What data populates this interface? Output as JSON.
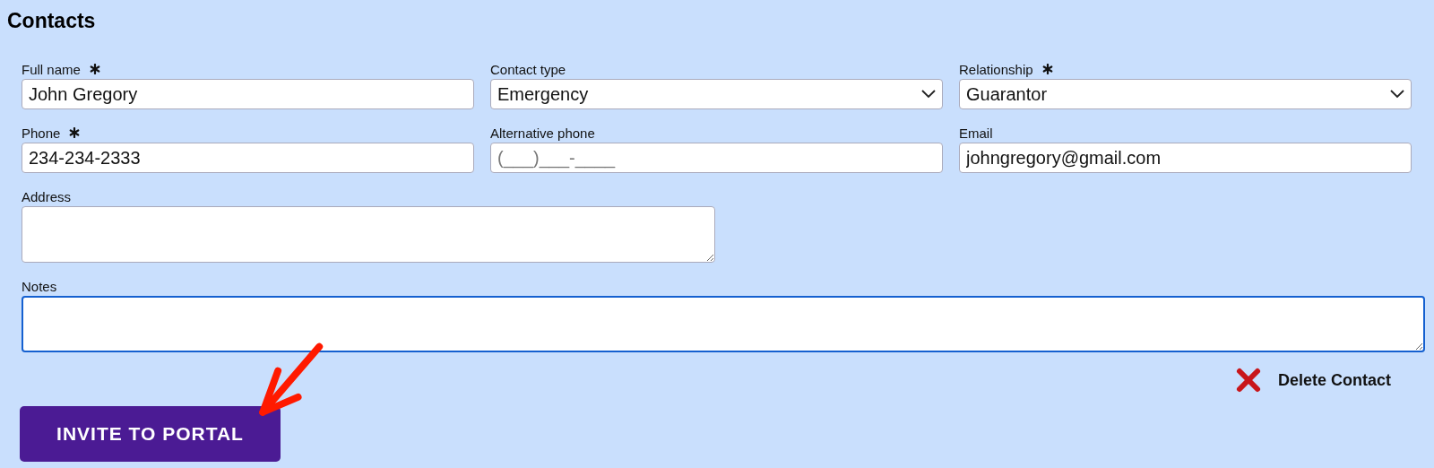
{
  "section": {
    "title": "Contacts"
  },
  "fields": [
    {
      "kind": "text",
      "label": "Full name",
      "required": true,
      "value": "John Gregory"
    },
    {
      "kind": "select",
      "label": "Contact type",
      "required": false,
      "value": "Emergency"
    },
    {
      "kind": "select",
      "label": "Relationship",
      "required": true,
      "value": "Guarantor"
    },
    {
      "kind": "text",
      "label": "Phone",
      "required": true,
      "value": "234-234-2333"
    },
    {
      "kind": "text",
      "label": "Alternative phone",
      "required": false,
      "placeholder": "(___)___-____"
    },
    {
      "kind": "text",
      "label": "Email",
      "required": false,
      "value": "johngregory@gmail.com"
    }
  ],
  "address": {
    "label": "Address",
    "focused": false
  },
  "notes": {
    "label": "Notes",
    "focused": true
  },
  "delete_link": {
    "label": "Delete Contact"
  },
  "invite_button": {
    "label": "INVITE TO PORTAL"
  }
}
